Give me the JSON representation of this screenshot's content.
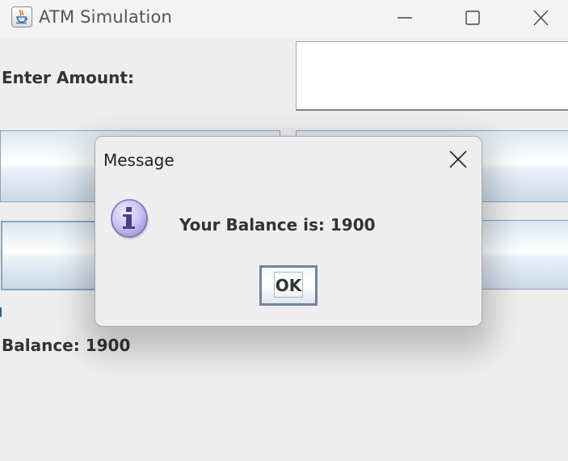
{
  "window": {
    "title": "ATM Simulation",
    "icon": "java-cup-icon"
  },
  "form": {
    "amount_label": "Enter Amount:",
    "amount_value": "",
    "balance_label": "Balance: 1900"
  },
  "dialog": {
    "title": "Message",
    "message": "Your Balance is: 1900",
    "ok_label": "OK",
    "icon": "info-icon"
  },
  "colors": {
    "background": "#eeeeee",
    "button_border": "#8da2b8",
    "info_icon_fill": "#c9c2f2"
  }
}
